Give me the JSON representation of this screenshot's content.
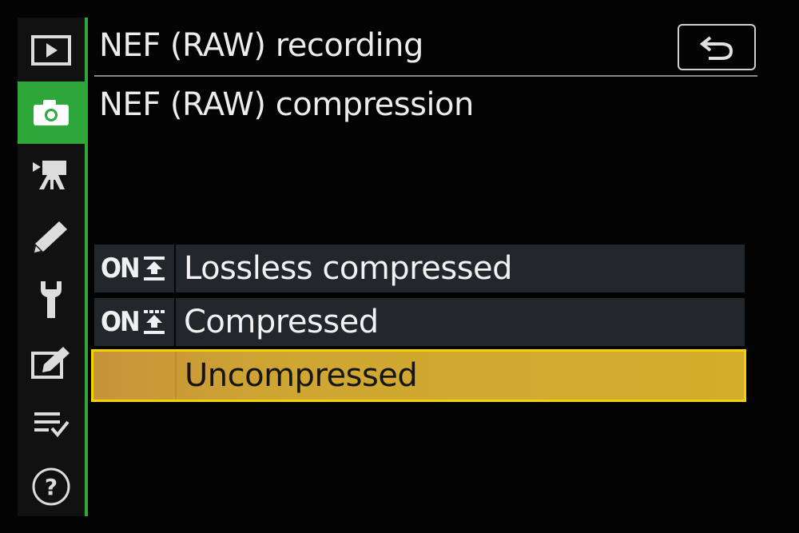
{
  "sidebar": {
    "items": [
      {
        "icon": "playback-icon",
        "active": false
      },
      {
        "icon": "camera-icon",
        "active": true
      },
      {
        "icon": "movie-camera-icon",
        "active": false
      },
      {
        "icon": "pencil-icon",
        "active": false
      },
      {
        "icon": "wrench-icon",
        "active": false
      },
      {
        "icon": "retouch-icon",
        "active": false
      },
      {
        "icon": "my-menu-icon",
        "active": false
      },
      {
        "icon": "help-icon",
        "active": false
      }
    ],
    "accent_color": "#2fa63a"
  },
  "header": {
    "title": "NEF (RAW) recording",
    "back_icon": "back-arrow-icon"
  },
  "subtitle": "NEF (RAW) compression",
  "options": [
    {
      "icon_text": "ON",
      "icon": "lossless-compressed-icon",
      "label": "Lossless compressed",
      "selected": false
    },
    {
      "icon_text": "ON",
      "icon": "compressed-icon",
      "label": "Compressed",
      "selected": false
    },
    {
      "icon_text": "",
      "icon": "",
      "label": "Uncompressed",
      "selected": true
    }
  ],
  "colors": {
    "selection": "#d2ae2c",
    "selection_border": "#f0d300",
    "option_bg": "#22272c"
  }
}
